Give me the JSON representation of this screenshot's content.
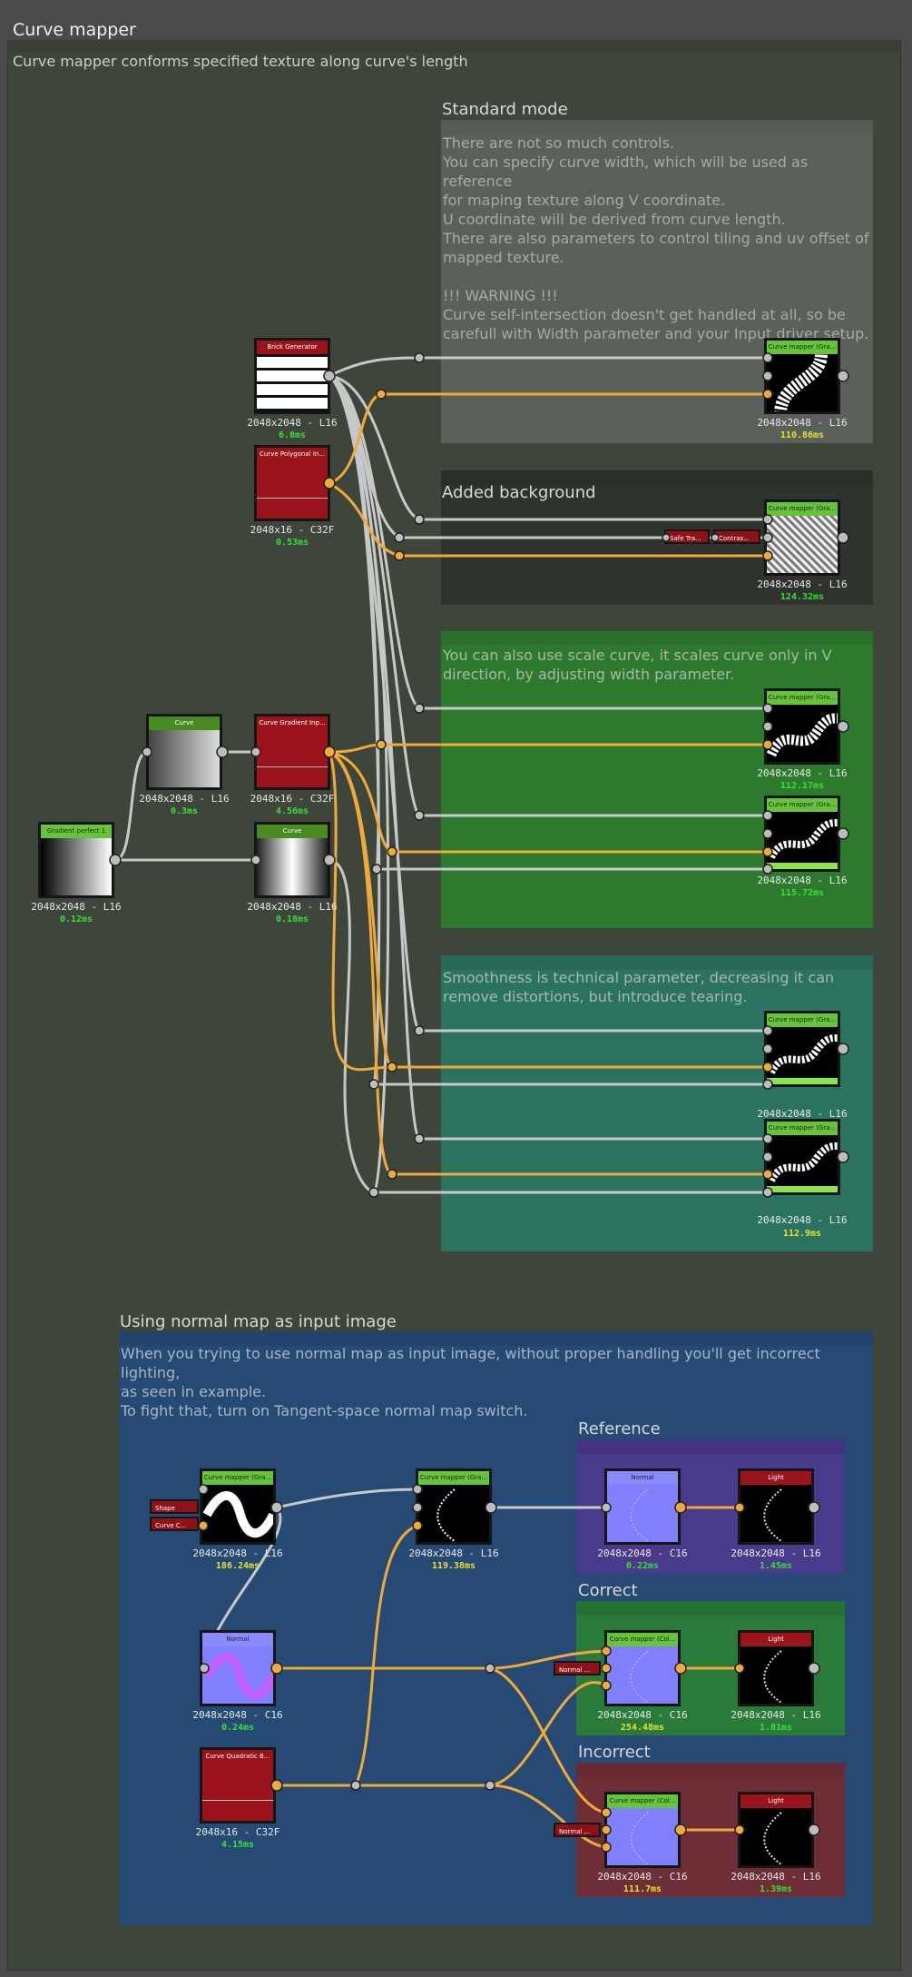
{
  "window": {
    "title": "Curve mapper",
    "description": "Curve mapper conforms specified texture along curve's length"
  },
  "frames": {
    "standard": {
      "title": "Standard mode",
      "text": "There are not so much controls.\nYou can specify curve width, which will be used as reference\nfor maping texture along V coordinate.\nU coordinate will be derived from curve length.\nThere are also parameters to control tiling and uv offset of\nmapped texture.\n\n!!! WARNING !!!\nCurve self-intersection doesn't get handled at all, so be\ncarefull with Width parameter and your Input driver setup."
    },
    "background": {
      "title": "Added background"
    },
    "scale": {
      "text": "You can also use scale curve, it scales curve only in V\ndirection, by adjusting width parameter."
    },
    "smooth": {
      "text": "Smoothness is technical parameter, decreasing it can\nremove distortions, but introduce tearing."
    },
    "normal": {
      "title": "Using normal map as input image",
      "text": "When you trying to use normal map as input image, without proper handling you'll get incorrect lighting,\nas seen in example.\nTo fight that, turn on Tangent-space normal map switch."
    },
    "reference": {
      "title": "Reference"
    },
    "correct": {
      "title": "Correct"
    },
    "incorrect": {
      "title": "Incorrect"
    }
  },
  "nodes": {
    "brick": {
      "title": "Brick Generator",
      "res": "2048x2048 - L16",
      "time": "6.8ms"
    },
    "poly": {
      "title": "Curve Polygonal In...",
      "res": "2048x16 - C32F",
      "time": "0.53ms"
    },
    "cm1": {
      "title": "Curve mapper (Gra...",
      "res": "2048x2048 - L16",
      "time": "110.86ms"
    },
    "cm2": {
      "title": "Curve mapper (Gra...",
      "res": "2048x2048 - L16",
      "time": "124.32ms"
    },
    "safe": {
      "title": "Safe Tra..."
    },
    "contrast": {
      "title": "Contras..."
    },
    "curve1": {
      "title": "Curve",
      "res": "2048x2048 - L16",
      "time": "0.3ms"
    },
    "gradin": {
      "title": "Curve Gradient Inp...",
      "res": "2048x16 - C32F",
      "time": "4.56ms"
    },
    "gradlin": {
      "title": "Gradient perfect 1",
      "res": "2048x2048 - L16",
      "time": "0.12ms"
    },
    "curve2": {
      "title": "Curve",
      "res": "2048x2048 - L16",
      "time": "0.18ms"
    },
    "cm3": {
      "title": "Curve mapper (Gra...",
      "res": "2048x2048 - L16",
      "time": "112.17ms"
    },
    "cm4": {
      "title": "Curve mapper (Gra...",
      "res": "2048x2048 - L16",
      "time": "115.72ms"
    },
    "cm5": {
      "title": "Curve mapper (Gra...",
      "res": "2048x2048 - L16",
      "time": ""
    },
    "cm6": {
      "title": "Curve mapper (Gra...",
      "res": "2048x2048 - L16",
      "time": "112.9ms"
    },
    "shape": {
      "title": "Shape"
    },
    "curvec": {
      "title": "Curve C..."
    },
    "cm7": {
      "title": "Curve mapper (Gra...",
      "res": "2048x2048 - L16",
      "time": "186.24ms"
    },
    "cm8": {
      "title": "Curve mapper (Gra...",
      "res": "2048x2048 - L16",
      "time": "119.38ms"
    },
    "normal1": {
      "title": "Normal",
      "res": "2048x2048 - C16",
      "time": "0.22ms"
    },
    "light1": {
      "title": "Light",
      "res": "2048x2048 - L16",
      "time": "1.45ms"
    },
    "normal2": {
      "title": "Normal",
      "res": "2048x2048 - C16",
      "time": "0.24ms"
    },
    "nm1": {
      "title": "Normal ..."
    },
    "cm9": {
      "title": "Curve mapper (Col...",
      "res": "2048x2048 - C16",
      "time": "254.48ms"
    },
    "light2": {
      "title": "Light",
      "res": "2048x2048 - L16",
      "time": "1.81ms"
    },
    "quad": {
      "title": "Curve Quadratic B...",
      "res": "2048x16 - C32F",
      "time": "4.15ms"
    },
    "nm2": {
      "title": "Normal ..."
    },
    "cm10": {
      "title": "Curve mapper (Col...",
      "res": "2048x2048 - C16",
      "time": "111.7ms"
    },
    "light3": {
      "title": "Light",
      "res": "2048x2048 - L16",
      "time": "1.39ms"
    }
  },
  "colors": {
    "green_time": "#36e036",
    "yellow_time": "#e8e030",
    "wire_white": "#c8c8c8",
    "wire_orange": "#f0aa3a"
  }
}
